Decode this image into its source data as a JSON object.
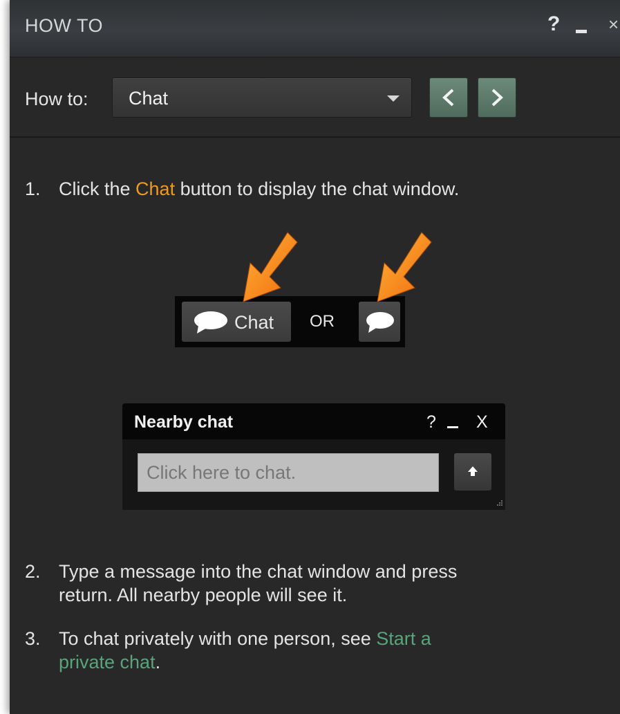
{
  "window": {
    "title": "HOW TO",
    "help": "?",
    "close": "×"
  },
  "howto": {
    "label": "How to:",
    "selected": "Chat"
  },
  "steps": [
    {
      "num": "1.",
      "pre": "Click the ",
      "highlight": "Chat",
      "post": " button to display the chat window."
    },
    {
      "num": "2.",
      "line1": "Type a message into the chat window and press",
      "line2": "return. All nearby people will see it."
    },
    {
      "num": "3.",
      "line1": "To chat privately with one person, see ",
      "link1": "Start a",
      "link2": "private chat",
      "post": "."
    }
  ],
  "example_toolbar": {
    "chat_label": "Chat",
    "or_label": "OR"
  },
  "nearby_chat": {
    "title": "Nearby chat",
    "help": "?",
    "close": "X",
    "placeholder": "Click here to chat."
  },
  "colors": {
    "accent_orange": "#f19a1a",
    "link_green": "#5aa37b",
    "nav_green": "#5c7a6a"
  },
  "icons": [
    "question-icon",
    "minimize-icon",
    "close-icon",
    "dropdown-caret-icon",
    "chevron-left-icon",
    "chevron-right-icon",
    "speech-bubble-icon",
    "arrow-down-icon",
    "arrow-up-icon",
    "resize-grip-icon"
  ]
}
